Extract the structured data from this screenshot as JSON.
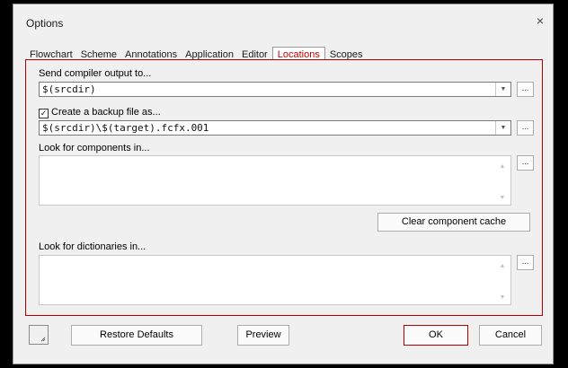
{
  "dialog": {
    "title": "Options",
    "close_glyph": "×"
  },
  "tabs": [
    {
      "label": "Flowchart",
      "active": false
    },
    {
      "label": "Scheme",
      "active": false
    },
    {
      "label": "Annotations",
      "active": false
    },
    {
      "label": "Application",
      "active": false
    },
    {
      "label": "Editor",
      "active": false
    },
    {
      "label": "Locations",
      "active": true
    },
    {
      "label": "Scopes",
      "active": false
    }
  ],
  "locations": {
    "compiler_output_label": "Send compiler output to...",
    "compiler_output_value": "$(srcdir)",
    "backup_checkbox_label": "Create a backup file as...",
    "backup_checked": true,
    "backup_value": "$(srcdir)\\$(target).fcfx.001",
    "components_label": "Look for components in...",
    "clear_cache_button": "Clear component cache",
    "dictionaries_label": "Look for dictionaries in...",
    "browse_label": "..."
  },
  "footer": {
    "restore_defaults": "Restore Defaults",
    "preview": "Preview",
    "ok": "OK",
    "cancel": "Cancel"
  },
  "icons": {
    "dropdown": "dropdown-arrow-icon",
    "scroll_up": "scroll-up-icon",
    "scroll_down": "scroll-down-icon",
    "check": "checkmark-icon",
    "resize": "resize-grip-icon"
  },
  "colors": {
    "accent_red": "#b40000",
    "active_tab_text": "#c00000",
    "dialog_bg": "#f0f0f0"
  }
}
